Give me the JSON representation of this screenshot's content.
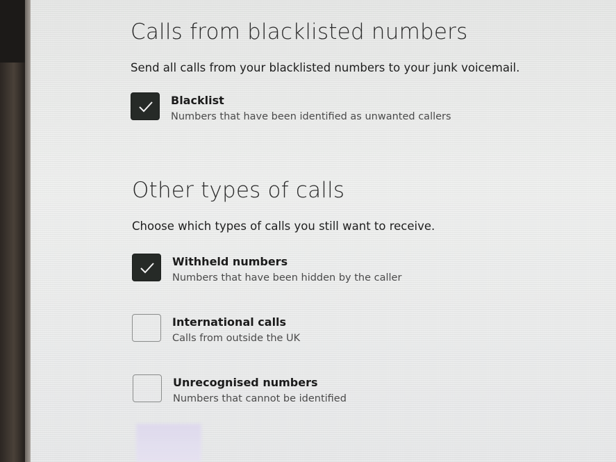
{
  "sections": [
    {
      "title": "Calls from blacklisted numbers",
      "description": "Send all calls from your blacklisted numbers to your junk voicemail.",
      "options": [
        {
          "label": "Blacklist",
          "description": "Numbers that have been identified as unwanted callers",
          "checked": true
        }
      ]
    },
    {
      "title": "Other types of calls",
      "description": "Choose which types of calls you still want to receive.",
      "options": [
        {
          "label": "Withheld numbers",
          "description": "Numbers that have been hidden by the caller",
          "checked": true
        },
        {
          "label": "International calls",
          "description": "Calls from outside the UK",
          "checked": false
        },
        {
          "label": "Unrecognised numbers",
          "description": "Numbers that cannot be identified",
          "checked": false
        }
      ]
    }
  ],
  "icons": {
    "checkmark": "checkmark-icon"
  },
  "colors": {
    "checkbox_checked": "#262a27",
    "checkbox_border": "#8b8d8c",
    "text": "#1b1b1b"
  }
}
